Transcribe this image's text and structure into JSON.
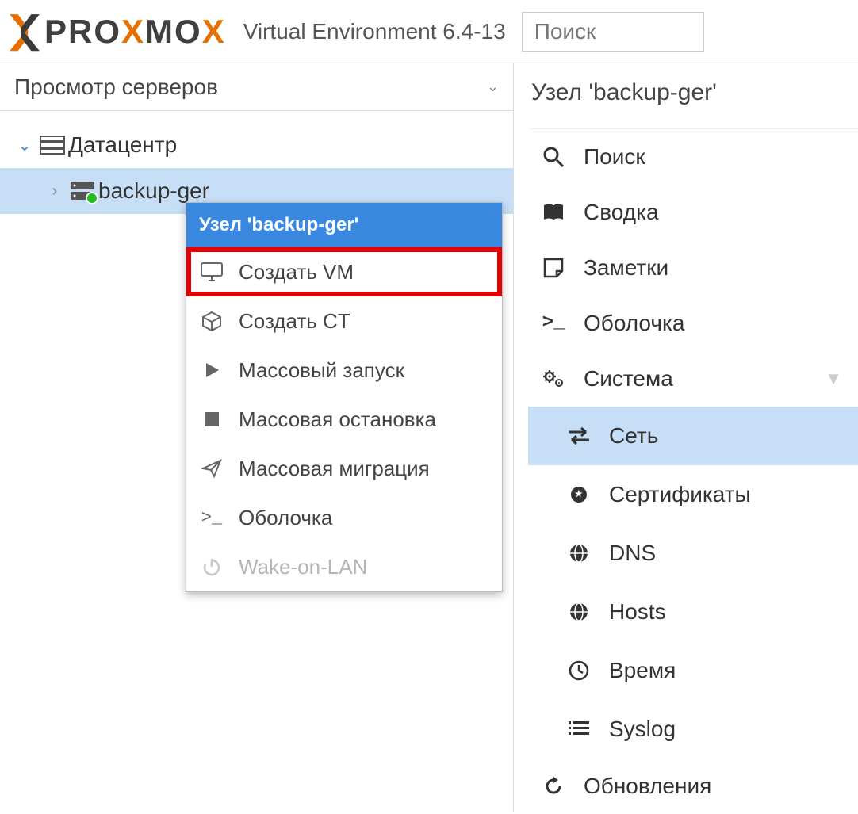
{
  "header": {
    "logo_text_1": "PRO",
    "logo_text_2": "MO",
    "product": "Virtual Environment 6.4-13",
    "search_placeholder": "Поиск"
  },
  "tree": {
    "view_label": "Просмотр серверов",
    "datacenter": "Датацентр",
    "node": "backup-ger"
  },
  "context_menu": {
    "title": "Узел 'backup-ger'",
    "create_vm": "Создать VM",
    "create_ct": "Создать CT",
    "bulk_start": "Массовый запуск",
    "bulk_stop": "Массовая остановка",
    "bulk_migrate": "Массовая миграция",
    "shell": "Оболочка",
    "wol": "Wake-on-LAN"
  },
  "panel": {
    "title": "Узел 'backup-ger'",
    "nav": {
      "search": "Поиск",
      "summary": "Сводка",
      "notes": "Заметки",
      "shell": "Оболочка",
      "system": "Система",
      "network": "Сеть",
      "certificates": "Сертификаты",
      "dns": "DNS",
      "hosts": "Hosts",
      "time": "Время",
      "syslog": "Syslog",
      "updates": "Обновления"
    }
  }
}
